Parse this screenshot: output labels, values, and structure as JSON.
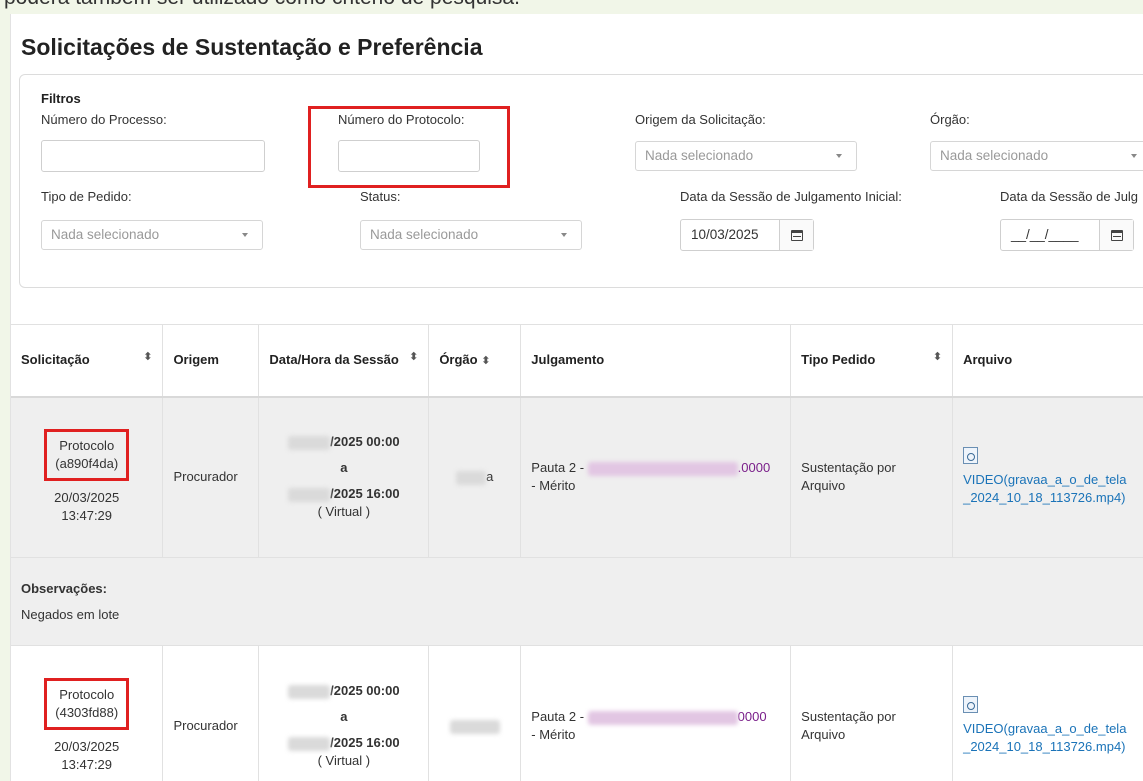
{
  "top_note": "poderá também ser utilizado como critério de pesquisa.",
  "page_title": "Solicitações de Sustentação e Preferência",
  "filters": {
    "title": "Filtros",
    "numero_processo_label": "Número do Processo:",
    "numero_protocolo_label": "Número do Protocolo:",
    "origem_label": "Origem da Solicitação:",
    "origem_value": "Nada selecionado",
    "orgao_label": "Órgão:",
    "orgao_value": "Nada selecionado",
    "tipo_pedido_label": "Tipo de Pedido:",
    "tipo_pedido_value": "Nada selecionado",
    "status_label": "Status:",
    "status_value": "Nada selecionado",
    "data_inicial_label": "Data da Sessão de Julgamento Inicial:",
    "data_inicial_value": "10/03/2025",
    "data_final_label": "Data da Sessão de Julg",
    "data_final_value": "__/__/____"
  },
  "table": {
    "headers": {
      "solicitacao": "Solicitação",
      "origem": "Origem",
      "data_hora": "Data/Hora da Sessão",
      "orgao": "Órgão",
      "julgamento": "Julgamento",
      "tipo_pedido": "Tipo Pedido",
      "arquivo": "Arquivo"
    },
    "sort_icon": "⬍",
    "rows": [
      {
        "protocolo_label": "Protocolo",
        "protocolo_id": "(a890f4da)",
        "data": "20/03/2025",
        "hora": "13:47:29",
        "origem": "Procurador",
        "sessao_inicio": "/2025 00:00",
        "sessao_a": "a",
        "sessao_fim": "/2025 16:00",
        "sessao_tipo": "( Virtual )",
        "orgao_suffix": "a",
        "julgamento_prefix": "Pauta 2 -",
        "julgamento_suffix": ".0000",
        "julgamento_tipo": "- Mérito",
        "tipo_pedido": "Sustentação por Arquivo",
        "arquivo": "VIDEO(gravaa_a_o_de_tela_2024_10_18_113726.mp4)"
      },
      {
        "protocolo_label": "Protocolo",
        "protocolo_id": "(4303fd88)",
        "data": "20/03/2025",
        "hora": "13:47:29",
        "origem": "Procurador",
        "sessao_inicio": "/2025 00:00",
        "sessao_a": "a",
        "sessao_fim": "/2025 16:00",
        "sessao_tipo": "( Virtual )",
        "orgao_suffix": "",
        "julgamento_prefix": "Pauta 2 -",
        "julgamento_suffix": "0000",
        "julgamento_tipo": "- Mérito",
        "tipo_pedido": "Sustentação por Arquivo",
        "arquivo": "VIDEO(gravaa_a_o_de_tela_2024_10_18_113726.mp4)"
      }
    ],
    "observacoes_label": "Observações:",
    "observacoes_text": "Negados em lote"
  },
  "colors": {
    "highlight": "#e02020",
    "link": "#1a73b8",
    "background": "#f1f6e8"
  }
}
